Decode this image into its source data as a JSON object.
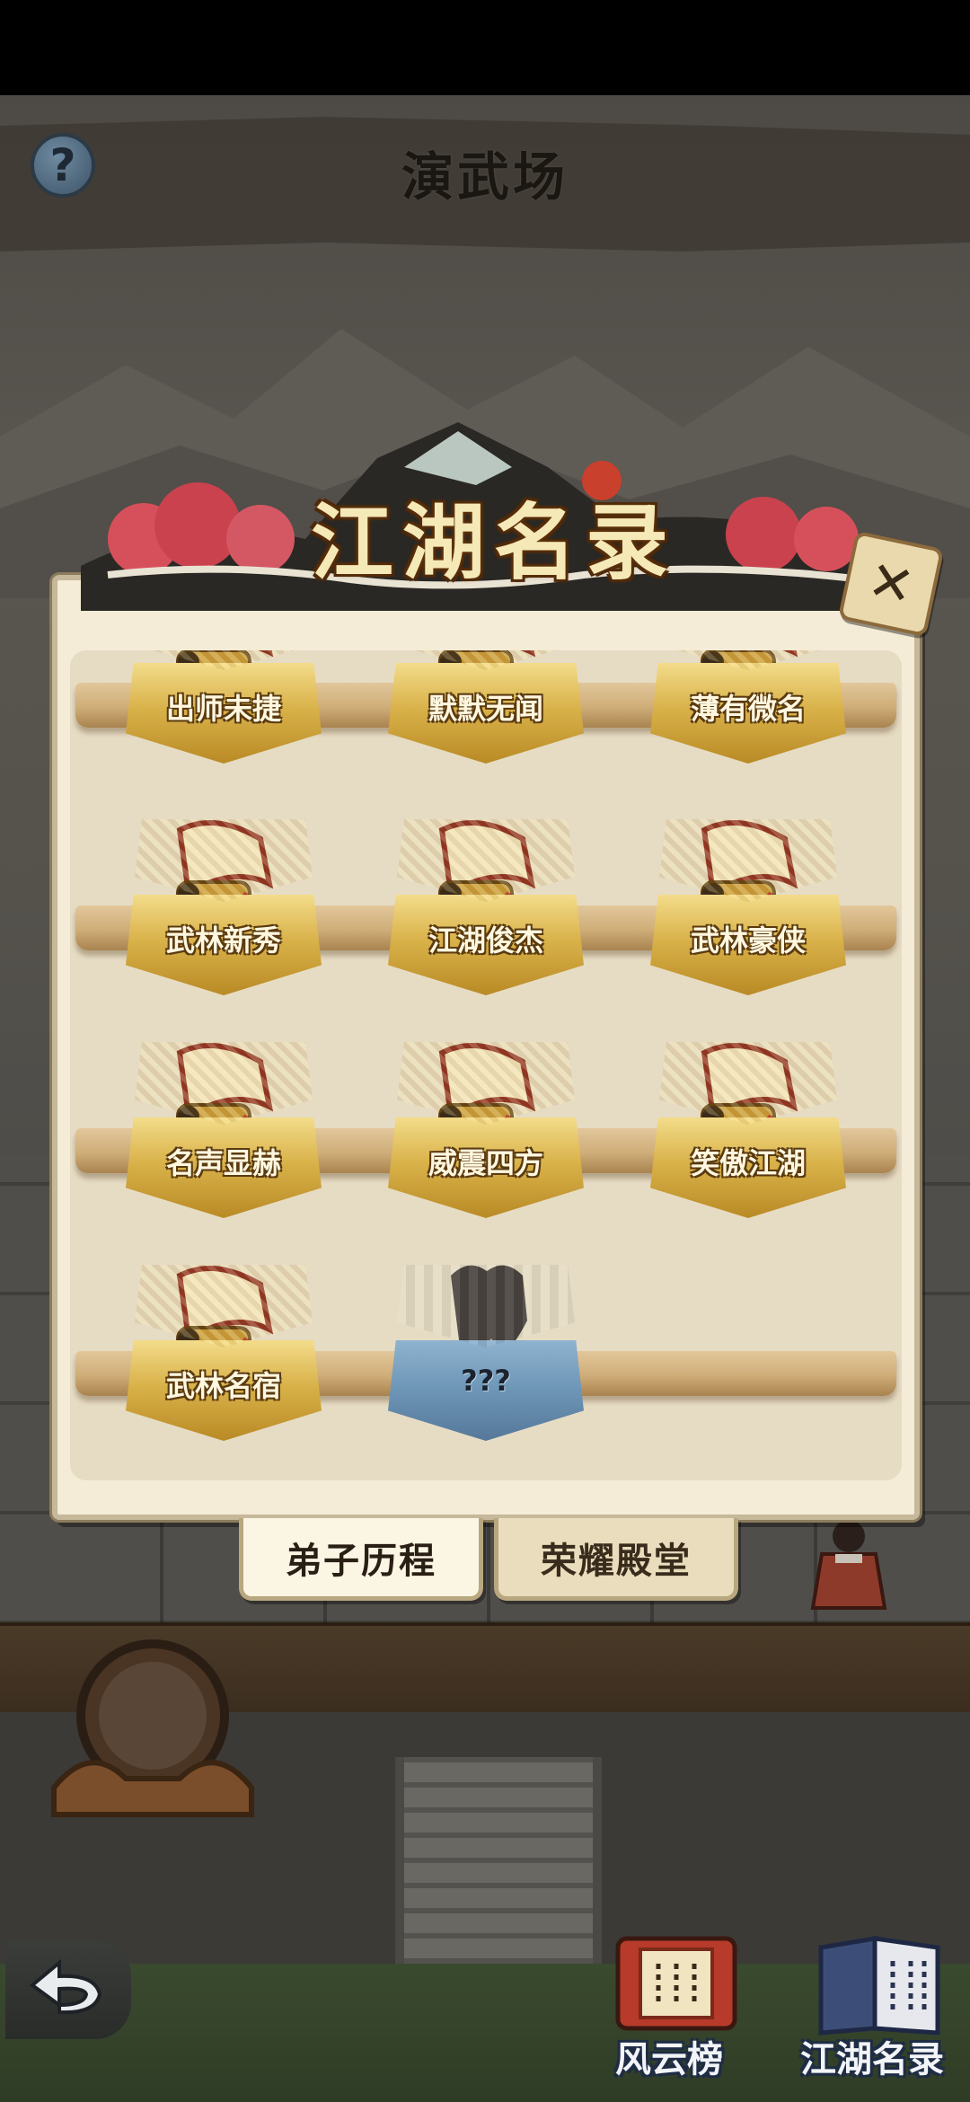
{
  "header": {
    "title": "演武场",
    "help_symbol": "?"
  },
  "dialog": {
    "title": "江湖名录",
    "close_symbol": "✕",
    "records": [
      {
        "label": "出师未捷",
        "locked": false
      },
      {
        "label": "默默无闻",
        "locked": false
      },
      {
        "label": "薄有微名",
        "locked": false
      },
      {
        "label": "武林新秀",
        "locked": false
      },
      {
        "label": "江湖俊杰",
        "locked": false
      },
      {
        "label": "武林豪侠",
        "locked": false
      },
      {
        "label": "名声显赫",
        "locked": false
      },
      {
        "label": "威震四方",
        "locked": false
      },
      {
        "label": "笑傲江湖",
        "locked": false
      },
      {
        "label": "武林名宿",
        "locked": false
      },
      {
        "label": "???",
        "locked": true
      }
    ],
    "tabs": [
      {
        "label": "弟子历程",
        "active": true
      },
      {
        "label": "荣耀殿堂",
        "active": false
      }
    ]
  },
  "bottom_menu": {
    "back_icon": "back-arrow-icon",
    "fengyun": {
      "label": "风云榜",
      "icon": "red-scroll-book-icon"
    },
    "jianghu": {
      "label": "江湖名录",
      "icon": "blue-book-icon"
    }
  },
  "colors": {
    "plaque_gold": "#d9b24a",
    "plaque_locked": "#6d95b6",
    "panel_bg": "#f4ecd6",
    "shelf_wood": "#cfad78"
  }
}
